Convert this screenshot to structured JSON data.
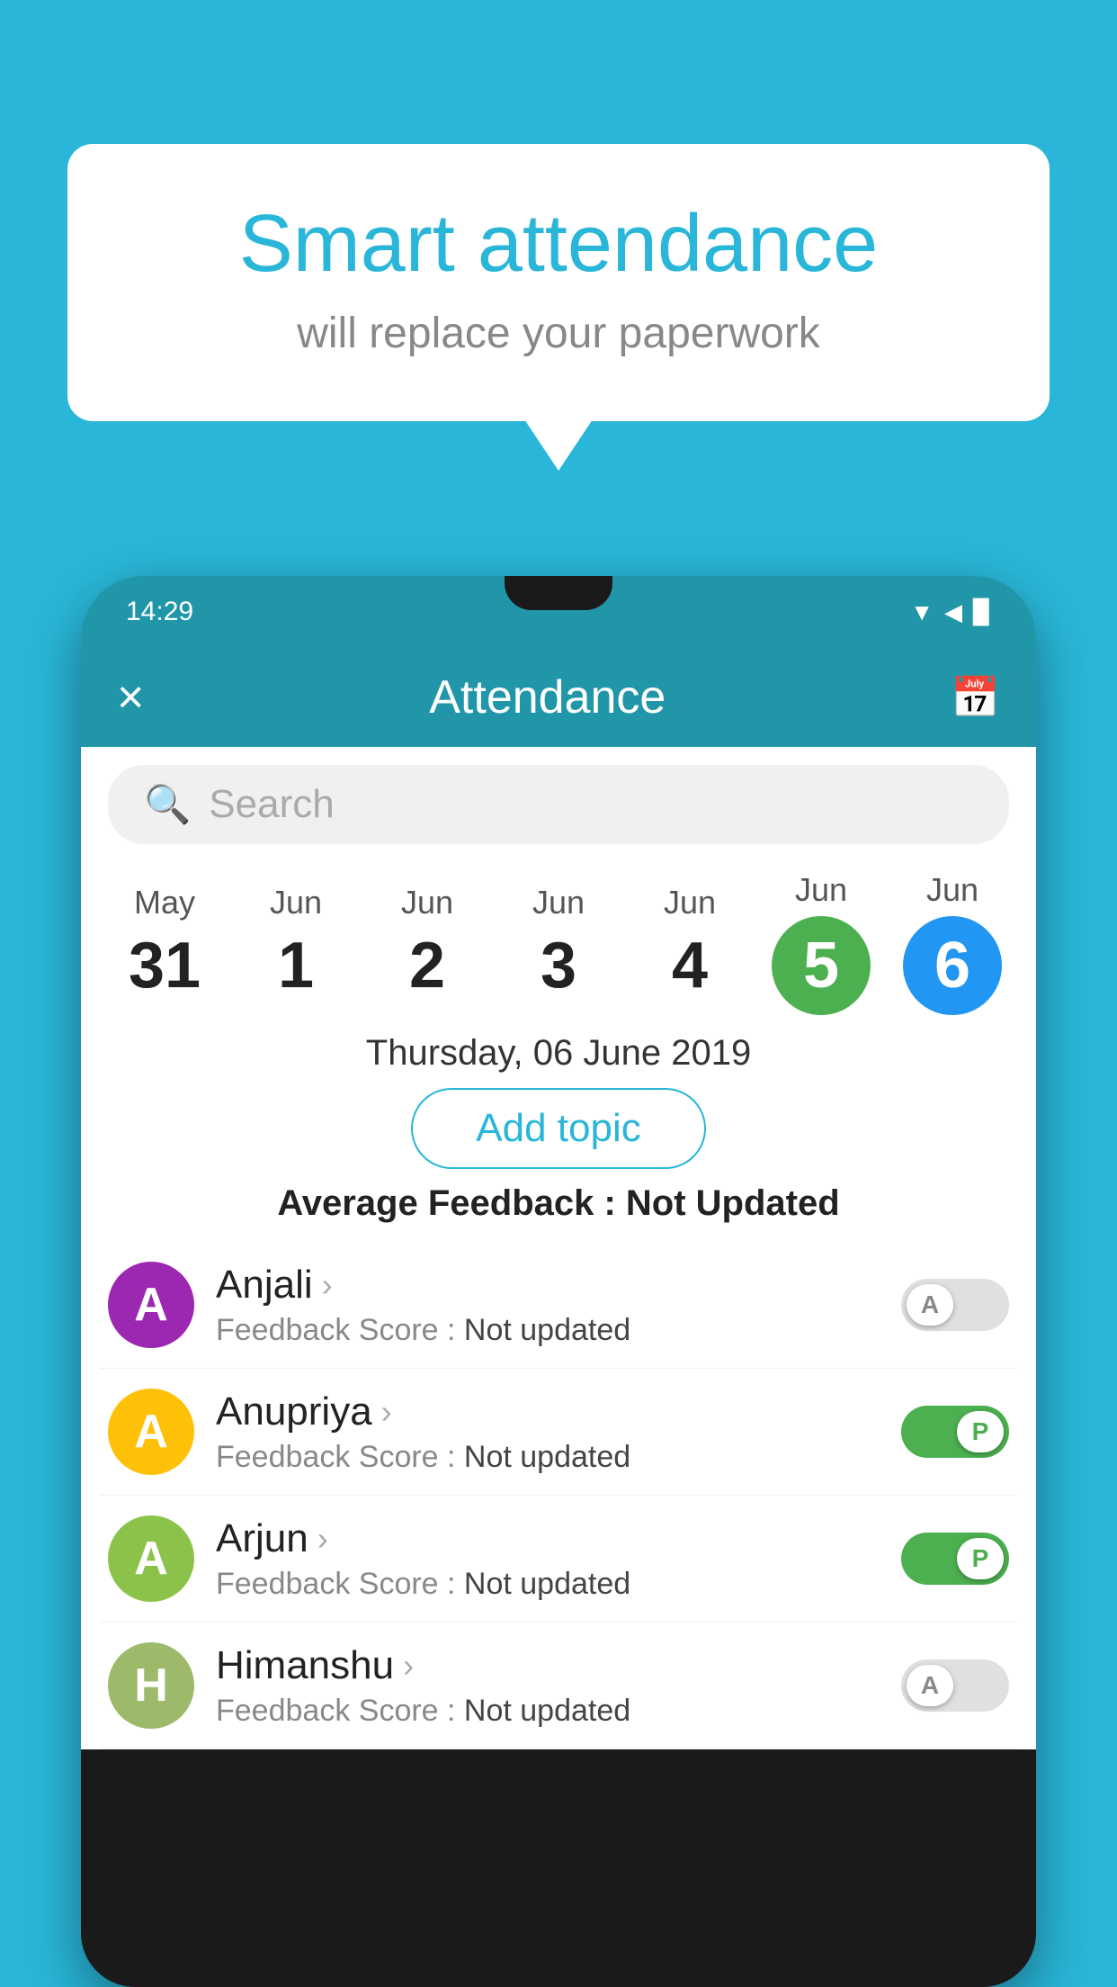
{
  "background_color": "#29b6d8",
  "bubble": {
    "title": "Smart attendance",
    "subtitle": "will replace your paperwork"
  },
  "status_bar": {
    "time": "14:29"
  },
  "header": {
    "title": "Attendance",
    "close_label": "×",
    "calendar_icon": "📅"
  },
  "search": {
    "placeholder": "Search"
  },
  "dates": [
    {
      "month": "May",
      "day": "31",
      "selected": false
    },
    {
      "month": "Jun",
      "day": "1",
      "selected": false
    },
    {
      "month": "Jun",
      "day": "2",
      "selected": false
    },
    {
      "month": "Jun",
      "day": "3",
      "selected": false
    },
    {
      "month": "Jun",
      "day": "4",
      "selected": false
    },
    {
      "month": "Jun",
      "day": "5",
      "selected": "green"
    },
    {
      "month": "Jun",
      "day": "6",
      "selected": "blue"
    }
  ],
  "selected_date_label": "Thursday, 06 June 2019",
  "add_topic_btn": "Add topic",
  "avg_feedback": {
    "label": "Average Feedback : ",
    "value": "Not Updated"
  },
  "students": [
    {
      "name": "Anjali",
      "initial": "A",
      "avatar_color": "avatar-purple",
      "feedback": "Not updated",
      "toggle": "off",
      "toggle_label": "A"
    },
    {
      "name": "Anupriya",
      "initial": "A",
      "avatar_color": "avatar-yellow",
      "feedback": "Not updated",
      "toggle": "on",
      "toggle_label": "P"
    },
    {
      "name": "Arjun",
      "initial": "A",
      "avatar_color": "avatar-green",
      "feedback": "Not updated",
      "toggle": "on",
      "toggle_label": "P"
    },
    {
      "name": "Himanshu",
      "initial": "H",
      "avatar_color": "avatar-olive",
      "feedback": "Not updated",
      "toggle": "off",
      "toggle_label": "A"
    }
  ]
}
